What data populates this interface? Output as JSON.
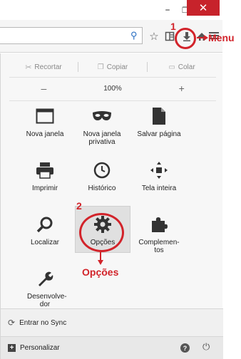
{
  "window": {
    "minimize_glyph": "–",
    "maximize_glyph": "❐",
    "close_glyph": "✕"
  },
  "toolbar": {
    "icons": [
      "search-icon",
      "bookmark-star-icon",
      "bookmarks-list-icon",
      "download-icon",
      "home-icon",
      "menu-icon"
    ]
  },
  "annotations": {
    "step1": "1",
    "step2": "2",
    "menu_label": "Menu",
    "options_label": "Opções",
    "color": "#d2232a"
  },
  "edit": {
    "cut": "Recortar",
    "copy": "Copiar",
    "paste": "Colar"
  },
  "zoom": {
    "minus": "–",
    "level": "100%",
    "plus": "+"
  },
  "grid": {
    "new_window": "Nova janela",
    "private_window": "Nova janela privativa",
    "save_page": "Salvar página",
    "print": "Imprimir",
    "history": "Histórico",
    "fullscreen": "Tela inteira",
    "find": "Localizar",
    "options": "Opções",
    "addons": "Complemen-tos",
    "developer": "Desenvolve-dor"
  },
  "footer": {
    "sync": "Entrar no Sync",
    "customize": "Personalizar"
  }
}
